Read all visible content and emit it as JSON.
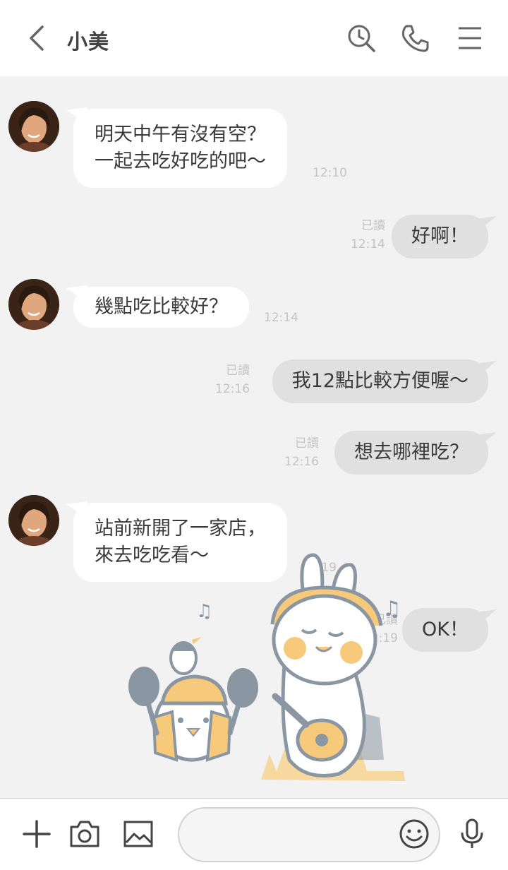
{
  "header": {
    "title": "小美"
  },
  "messages": {
    "m1": {
      "text": "明天中午有沒有空？\n一起去吃好吃的吧～",
      "time": "12:10"
    },
    "m2": {
      "text": "好啊！",
      "read": "已讀",
      "time": "12:14"
    },
    "m3": {
      "text": "幾點吃比較好？",
      "time": "12:14"
    },
    "m4": {
      "text": "我12點比較方便喔～",
      "read": "已讀",
      "time": "12:16"
    },
    "m5": {
      "text": "想去哪裡吃？",
      "read": "已讀",
      "time": "12:16"
    },
    "m6": {
      "text": "站前新開了一家店，\n來去吃吃看～",
      "time": "12:19"
    },
    "m7": {
      "text": "OK！",
      "read": "已讀",
      "time": "12:19"
    }
  },
  "composer": {
    "placeholder": ""
  },
  "colors": {
    "incoming_bubble": "#ffffff",
    "outgoing_bubble": "#e0e0e0",
    "chat_background": "#f2f2f2",
    "sticker_accent": "#f7c97a",
    "sticker_outline": "#8a97a3"
  },
  "icons": [
    "back-chevron-icon",
    "search-history-icon",
    "phone-icon",
    "menu-icon",
    "plus-icon",
    "camera-icon",
    "image-icon",
    "emoji-icon",
    "microphone-icon"
  ]
}
